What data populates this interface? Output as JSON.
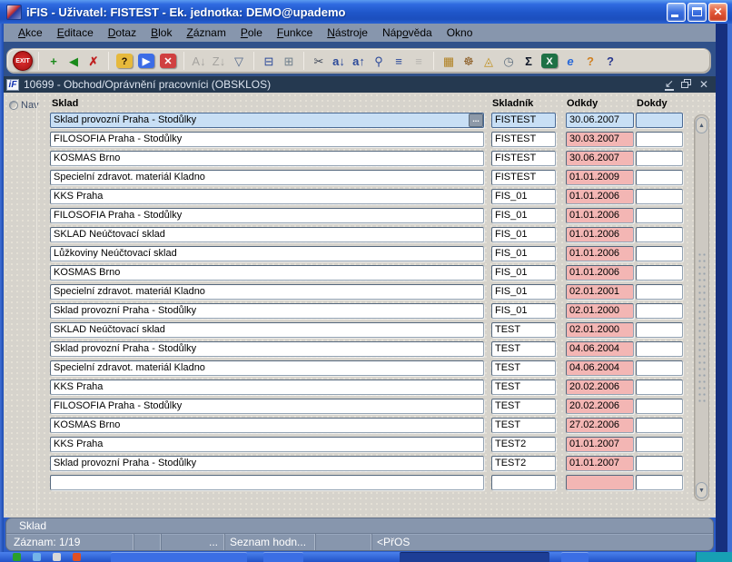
{
  "window": {
    "title": "iFIS - Uživatel: FISTEST - Ek. jednotka: DEMO@upademo"
  },
  "menu": {
    "items": [
      {
        "label": "Akce",
        "mnemonic": 0
      },
      {
        "label": "Editace",
        "mnemonic": 0
      },
      {
        "label": "Dotaz",
        "mnemonic": 0
      },
      {
        "label": "Blok",
        "mnemonic": 0
      },
      {
        "label": "Záznam",
        "mnemonic": 0
      },
      {
        "label": "Pole",
        "mnemonic": 0
      },
      {
        "label": "Funkce",
        "mnemonic": 0
      },
      {
        "label": "Nástroje",
        "mnemonic": 0
      },
      {
        "label": "Nápověda",
        "mnemonic": 3
      },
      {
        "label": "Okno",
        "mnemonic": -1
      }
    ]
  },
  "toolbar": {
    "items": [
      {
        "name": "exit-button",
        "type": "exit",
        "label": "EXIT"
      },
      {
        "type": "sep"
      },
      {
        "name": "insert-record-icon",
        "glyph": "+",
        "fg": "#1a8a1a",
        "bold": true
      },
      {
        "name": "copy-record-icon",
        "glyph": "◀",
        "fg": "#1a8a1a"
      },
      {
        "name": "delete-record-icon",
        "glyph": "✗",
        "fg": "#c02020",
        "bold": true
      },
      {
        "type": "sep"
      },
      {
        "name": "enter-query-icon",
        "glyph": "?",
        "fg": "#201000",
        "bg": "#e6b93c"
      },
      {
        "name": "execute-query-icon",
        "glyph": "▶",
        "fg": "#ffffff",
        "bg": "#3c6ce6"
      },
      {
        "name": "cancel-query-icon",
        "glyph": "✕",
        "fg": "#ffffff",
        "bg": "#d04040"
      },
      {
        "type": "sep"
      },
      {
        "name": "sort-asc-icon",
        "glyph": "A↓",
        "fg": "#5a6a7a",
        "disabled": true
      },
      {
        "name": "sort-desc-icon",
        "glyph": "Z↓",
        "fg": "#5a6a7a",
        "disabled": true
      },
      {
        "name": "filter-icon",
        "glyph": "▽",
        "fg": "#50668a"
      },
      {
        "type": "sep"
      },
      {
        "name": "print-icon",
        "glyph": "⊟",
        "fg": "#2c4a9a"
      },
      {
        "name": "print-setup-icon",
        "glyph": "⊞",
        "fg": "#70808e"
      },
      {
        "type": "sep"
      },
      {
        "name": "cut-icon",
        "glyph": "✂",
        "fg": "#40495a"
      },
      {
        "name": "copy-icon",
        "glyph": "a↓",
        "fg": "#2c4a9a",
        "bold": true
      },
      {
        "name": "paste-icon",
        "glyph": "a↑",
        "fg": "#2c4a9a",
        "bold": true
      },
      {
        "name": "find-icon",
        "glyph": "⚲",
        "fg": "#2c4a9a"
      },
      {
        "name": "list-block-icon",
        "glyph": "≡",
        "fg": "#2c4a9a",
        "bold": true
      },
      {
        "name": "tree-icon",
        "glyph": "≡",
        "fg": "#8a8f98",
        "disabled": true
      },
      {
        "type": "sep"
      },
      {
        "name": "editor-icon",
        "glyph": "▦",
        "fg": "#b08020"
      },
      {
        "name": "navigator-helm-icon",
        "glyph": "☸",
        "fg": "#8a5a20"
      },
      {
        "name": "hint-lamp-icon",
        "glyph": "◬",
        "fg": "#c09020"
      },
      {
        "name": "calendar-clock-icon",
        "glyph": "◷",
        "fg": "#607080"
      },
      {
        "name": "sum-icon",
        "glyph": "Σ",
        "fg": "#101828",
        "bold": true
      },
      {
        "name": "excel-export-icon",
        "glyph": "X",
        "fg": "#ffffff",
        "bg": "#1e7145"
      },
      {
        "name": "web-browser-icon",
        "glyph": "e",
        "fg": "#2868d8",
        "bold": true,
        "italic": true
      },
      {
        "name": "context-help-icon",
        "glyph": "?",
        "fg": "#d08020",
        "bold": true
      },
      {
        "name": "help-icon",
        "glyph": "?",
        "fg": "#283890",
        "bold": true
      }
    ]
  },
  "form_window": {
    "icon": "iF",
    "title": "10699 - Obchod/Oprávnění pracovníci (OBSKLOS)"
  },
  "nav": {
    "label": "Nav"
  },
  "table": {
    "columns": [
      "Sklad",
      "Skladník",
      "Odkdy",
      "Dokdy"
    ],
    "lov_label": "...",
    "selected_row": 0,
    "rows": [
      {
        "sklad": "Sklad provozní Praha - Stodůlky",
        "skladnik": "FISTEST",
        "odkdy": "30.06.2007",
        "dokdy": ""
      },
      {
        "sklad": "FILOSOFIA Praha - Stodůlky",
        "skladnik": "FISTEST",
        "odkdy": "30.03.2007",
        "dokdy": ""
      },
      {
        "sklad": "KOSMAS Brno",
        "skladnik": "FISTEST",
        "odkdy": "30.06.2007",
        "dokdy": ""
      },
      {
        "sklad": "Specielní zdravot. materiál Kladno",
        "skladnik": "FISTEST",
        "odkdy": "01.01.2009",
        "dokdy": ""
      },
      {
        "sklad": "KKS Praha",
        "skladnik": "FIS_01",
        "odkdy": "01.01.2006",
        "dokdy": ""
      },
      {
        "sklad": "FILOSOFIA Praha - Stodůlky",
        "skladnik": "FIS_01",
        "odkdy": "01.01.2006",
        "dokdy": ""
      },
      {
        "sklad": "SKLAD Neúčtovací sklad",
        "skladnik": "FIS_01",
        "odkdy": "01.01.2006",
        "dokdy": ""
      },
      {
        "sklad": "Lůžkoviny Neúčtovací sklad",
        "skladnik": "FIS_01",
        "odkdy": "01.01.2006",
        "dokdy": ""
      },
      {
        "sklad": "KOSMAS Brno",
        "skladnik": "FIS_01",
        "odkdy": "01.01.2006",
        "dokdy": ""
      },
      {
        "sklad": "Specielní zdravot. materiál Kladno",
        "skladnik": "FIS_01",
        "odkdy": "02.01.2001",
        "dokdy": ""
      },
      {
        "sklad": "Sklad provozní Praha - Stodůlky",
        "skladnik": "FIS_01",
        "odkdy": "02.01.2000",
        "dokdy": ""
      },
      {
        "sklad": "SKLAD Neúčtovací sklad",
        "skladnik": "TEST",
        "odkdy": "02.01.2000",
        "dokdy": ""
      },
      {
        "sklad": "Sklad provozní Praha - Stodůlky",
        "skladnik": "TEST",
        "odkdy": "04.06.2004",
        "dokdy": ""
      },
      {
        "sklad": "Specielní zdravot. materiál Kladno",
        "skladnik": "TEST",
        "odkdy": "04.06.2004",
        "dokdy": ""
      },
      {
        "sklad": "KKS Praha",
        "skladnik": "TEST",
        "odkdy": "20.02.2006",
        "dokdy": ""
      },
      {
        "sklad": "FILOSOFIA Praha - Stodůlky",
        "skladnik": "TEST",
        "odkdy": "20.02.2006",
        "dokdy": ""
      },
      {
        "sklad": "KOSMAS Brno",
        "skladnik": "TEST",
        "odkdy": "27.02.2006",
        "dokdy": ""
      },
      {
        "sklad": "KKS Praha",
        "skladnik": "TEST2",
        "odkdy": "01.01.2007",
        "dokdy": ""
      },
      {
        "sklad": "Sklad provozní Praha - Stodůlky",
        "skladnik": "TEST2",
        "odkdy": "01.01.2007",
        "dokdy": ""
      },
      {
        "sklad": "",
        "skladnik": "",
        "odkdy": "",
        "dokdy": ""
      }
    ]
  },
  "statusbar": {
    "hint": "Sklad",
    "record_counter": "Záznam: 1/19",
    "cell_dots": "...",
    "cell_lov": "Seznam hodn...",
    "cell_mode": "<PřOS"
  },
  "colors": {
    "titlebar_blue": "#1e55c8",
    "menubar": "#8796ad",
    "toolbar_bg": "#d9d5cd",
    "mdi_title_bg": "#253950",
    "canvas": "#d6d3cc",
    "field_selected": "#c8dff5",
    "field_required": "#f3b6b4",
    "status_bg": "#8796ad",
    "taskbar_blue": "#2253c8"
  }
}
